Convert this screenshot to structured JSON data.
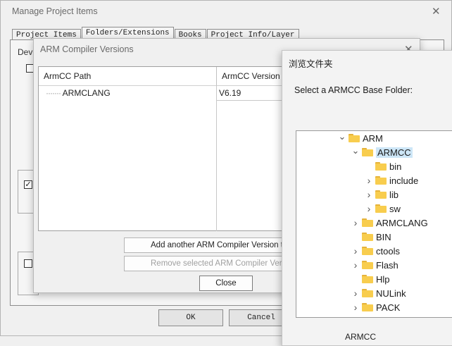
{
  "manage_dialog": {
    "title": "Manage Project Items",
    "tabs": [
      "Project Items",
      "Folders/Extensions",
      "Books",
      "Project Info/Layer"
    ],
    "device_label": "Dev",
    "ok_label": "OK",
    "cancel_label": "Cancel"
  },
  "compiler_dialog": {
    "title": "ARM Compiler Versions",
    "columns": [
      "ArmCC Path",
      "ArmCC Version"
    ],
    "rows": [
      {
        "path": "ARMCLANG",
        "version": "V6.19"
      }
    ],
    "add_button": "Add another ARM Compiler Version to List...",
    "remove_button": "Remove selected ARM Compiler Version from List",
    "close_button": "Close"
  },
  "browse_dialog": {
    "title": "浏览文件夹",
    "prompt": "Select a ARMCC Base Folder:",
    "tree": [
      {
        "label": "ARM",
        "depth": 0,
        "chevron": "expanded"
      },
      {
        "label": "ARMCC",
        "depth": 1,
        "chevron": "expanded",
        "selected": true
      },
      {
        "label": "bin",
        "depth": 2,
        "chevron": "none"
      },
      {
        "label": "include",
        "depth": 2,
        "chevron": "collapsed"
      },
      {
        "label": "lib",
        "depth": 2,
        "chevron": "collapsed"
      },
      {
        "label": "sw",
        "depth": 2,
        "chevron": "collapsed"
      },
      {
        "label": "ARMCLANG",
        "depth": 1,
        "chevron": "collapsed"
      },
      {
        "label": "BIN",
        "depth": 1,
        "chevron": "none"
      },
      {
        "label": "ctools",
        "depth": 1,
        "chevron": "collapsed"
      },
      {
        "label": "Flash",
        "depth": 1,
        "chevron": "collapsed"
      },
      {
        "label": "Hlp",
        "depth": 1,
        "chevron": "none"
      },
      {
        "label": "NULink",
        "depth": 1,
        "chevron": "collapsed"
      },
      {
        "label": "PACK",
        "depth": 1,
        "chevron": "collapsed"
      }
    ],
    "folder_field": "ARMCC"
  },
  "icons": {
    "close": "close-icon",
    "folder": "folder-icon",
    "chevron_expanded": "chevron-down-icon",
    "chevron_collapsed": "chevron-right-icon"
  },
  "colors": {
    "dialog_bg": "#f0f0f0",
    "selection": "#cde6f7",
    "folder": "#f8cd4e"
  }
}
